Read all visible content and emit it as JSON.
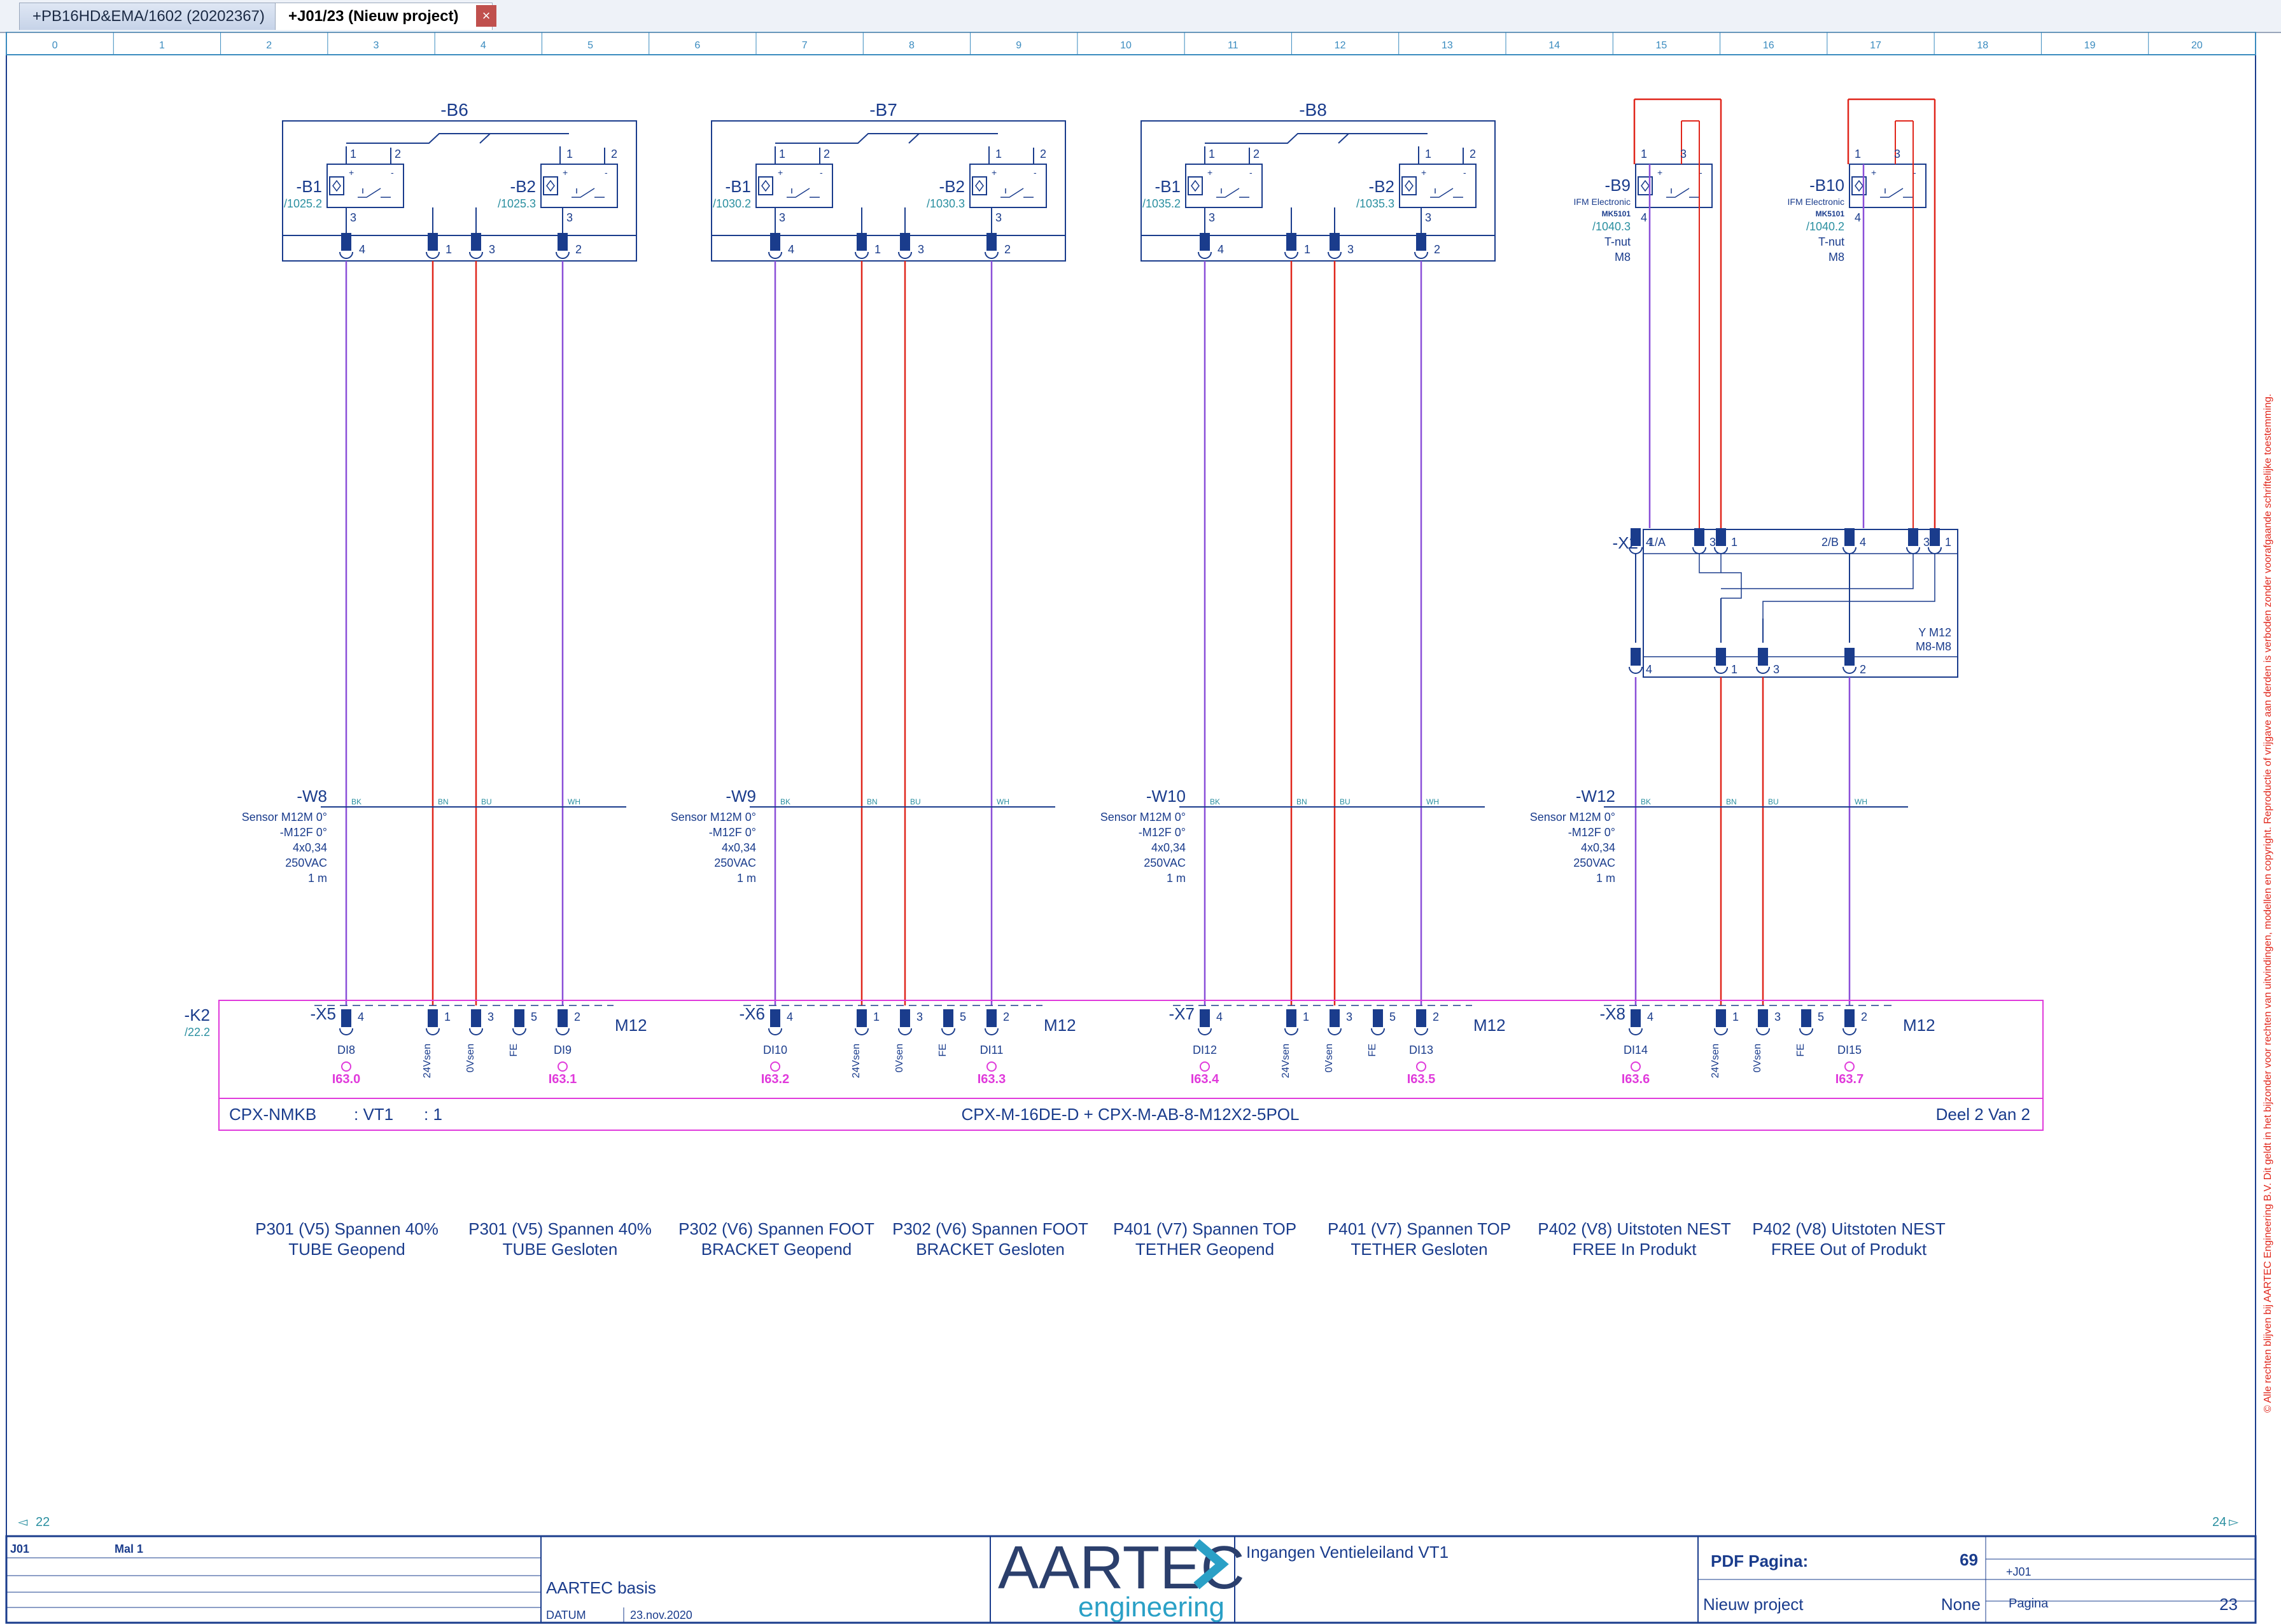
{
  "tabs": [
    {
      "label": "+PB16HD&EMA/1602 (20202367)"
    },
    {
      "label": "+J01/23 (Nieuw project)"
    }
  ],
  "close_glyph": "×",
  "ruler": {
    "cols": [
      "0",
      "1",
      "2",
      "3",
      "4",
      "5",
      "6",
      "7",
      "8",
      "9",
      "10",
      "11",
      "12",
      "13",
      "14",
      "15",
      "16",
      "17",
      "18",
      "19",
      "20"
    ]
  },
  "colors": {
    "blue": "#1a3c8c",
    "teal": "#2a8fa0",
    "red": "#e0261b",
    "purple": "#8a4fd8",
    "magenta": "#e03adb",
    "ruler": "#3a8bbf"
  },
  "groups": [
    {
      "tag": "-B6",
      "left": {
        "tag": "-B1",
        "ref": "/1025.2"
      },
      "right": {
        "tag": "-B2",
        "ref": "/1025.3"
      },
      "cable": {
        "tag": "-W8"
      },
      "conn": "-X5",
      "di_left": "DI8",
      "di_right": "DI9",
      "addr_left": "I63.0",
      "addr_right": "I63.1"
    },
    {
      "tag": "-B7",
      "left": {
        "tag": "-B1",
        "ref": "/1030.2"
      },
      "right": {
        "tag": "-B2",
        "ref": "/1030.3"
      },
      "cable": {
        "tag": "-W9"
      },
      "conn": "-X6",
      "di_left": "DI10",
      "di_right": "DI11",
      "addr_left": "I63.2",
      "addr_right": "I63.3"
    },
    {
      "tag": "-B8",
      "left": {
        "tag": "-B1",
        "ref": "/1035.2"
      },
      "right": {
        "tag": "-B2",
        "ref": "/1035.3"
      },
      "cable": {
        "tag": "-W10"
      },
      "conn": "-X7",
      "di_left": "DI12",
      "di_right": "DI13",
      "addr_left": "I63.4",
      "addr_right": "I63.5"
    }
  ],
  "group4": {
    "sensors": [
      {
        "tag": "-B9",
        "maker": "IFM Electronic",
        "part": "MK5101",
        "ref": "/1040.3",
        "line1": "T-nut",
        "line2": "M8"
      },
      {
        "tag": "-B10",
        "maker": "IFM Electronic",
        "part": "MK5101",
        "ref": "/1040.2",
        "line1": "T-nut",
        "line2": "M8"
      }
    ],
    "splitter": {
      "tag": "-X2",
      "port_a": "1/A",
      "port_b": "2/B",
      "type1": "Y M12",
      "type2": "M8-M8"
    },
    "cable": {
      "tag": "-W12"
    },
    "conn": "-X8",
    "di_left": "DI14",
    "di_right": "DI15",
    "addr_left": "I63.6",
    "addr_right": "I63.7"
  },
  "cable_spec": [
    "Sensor M12M 0°",
    "-M12F 0°",
    "4x0,34",
    "250VAC",
    "1 m"
  ],
  "wire_codes": [
    "BK",
    "BN",
    "BU",
    "WH"
  ],
  "pin_labels": {
    "p24": "24Vsen",
    "p0": "0Vsen",
    "fe": "FE",
    "m12": "M12"
  },
  "module": {
    "tag": "-K2",
    "ref": "/22.2",
    "left": "CPX-NMKB",
    "vt": ": VT1",
    "one": ": 1",
    "center": "CPX-M-16DE-D + CPX-M-AB-8-M12X2-5POL",
    "right": "Deel 2 Van 2"
  },
  "descriptions": [
    [
      "P301 (V5) Spannen 40%",
      "TUBE Geopend"
    ],
    [
      "P301 (V5) Spannen 40%",
      "TUBE Gesloten"
    ],
    [
      "P302 (V6) Spannen FOOT",
      "BRACKET Geopend"
    ],
    [
      "P302 (V6) Spannen FOOT",
      "BRACKET Gesloten"
    ],
    [
      "P401 (V7) Spannen TOP",
      "TETHER Geopend"
    ],
    [
      "P401 (V7) Spannen TOP",
      "TETHER Gesloten"
    ],
    [
      "P402 (V8) Uitstoten NEST",
      "FREE In Produkt"
    ],
    [
      "P402 (V8) Uitstoten NEST",
      "FREE Out of Produkt"
    ]
  ],
  "copyright": "© Alle rechten blijven bij AARTEC Engineering B.V. Dit geldt in het bijzonder voor rechten van uitvindingen, modellen en copyright. Reproductie of vrijgave aan derden is verboden zonder voorafgaande schriftelijke toestemming.",
  "page_prev": "22",
  "page_next": "24",
  "titleblock": {
    "code": "J01",
    "mal": "Mal 1",
    "basis": "AARTEC basis",
    "datum_label": "DATUM",
    "datum": "23.nov.2020",
    "logo_main": "AARTEC",
    "logo_sub": "engineering",
    "title": "Ingangen Ventieleiland VT1",
    "pdf_label": "PDF Pagina:",
    "pdf_value": "69",
    "loc": "+J01",
    "project": "Nieuw project",
    "none": "None",
    "pagina_label": "Pagina",
    "pagina": "23"
  }
}
